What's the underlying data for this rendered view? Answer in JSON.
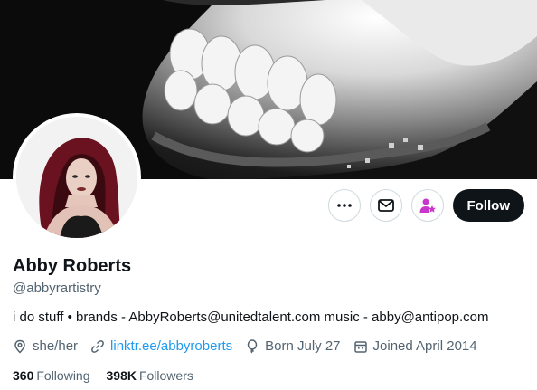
{
  "banner": {
    "description": ""
  },
  "profile": {
    "name": "Abby Roberts",
    "handle": "@abbyrartistry",
    "bio": "i do stuff • brands - AbbyRoberts@unitedtalent.com music - abby@antipop.com"
  },
  "actions": {
    "more_icon": "more-horizontal-icon",
    "message_icon": "envelope-icon",
    "subscribe_icon": "person-star-icon",
    "follow_label": "Follow"
  },
  "meta": {
    "pronouns": "she/her",
    "link": "linktr.ee/abbyroberts",
    "birthday": "Born July 27",
    "joined": "Joined April 2014"
  },
  "stats": {
    "following_count": "360",
    "following_label": "Following",
    "followers_count": "398K",
    "followers_label": "Followers"
  },
  "colors": {
    "link": "#1d9bf0",
    "secondary_text": "#536471",
    "primary_text": "#0f1419",
    "subscribe_accent": "#c936cc"
  }
}
